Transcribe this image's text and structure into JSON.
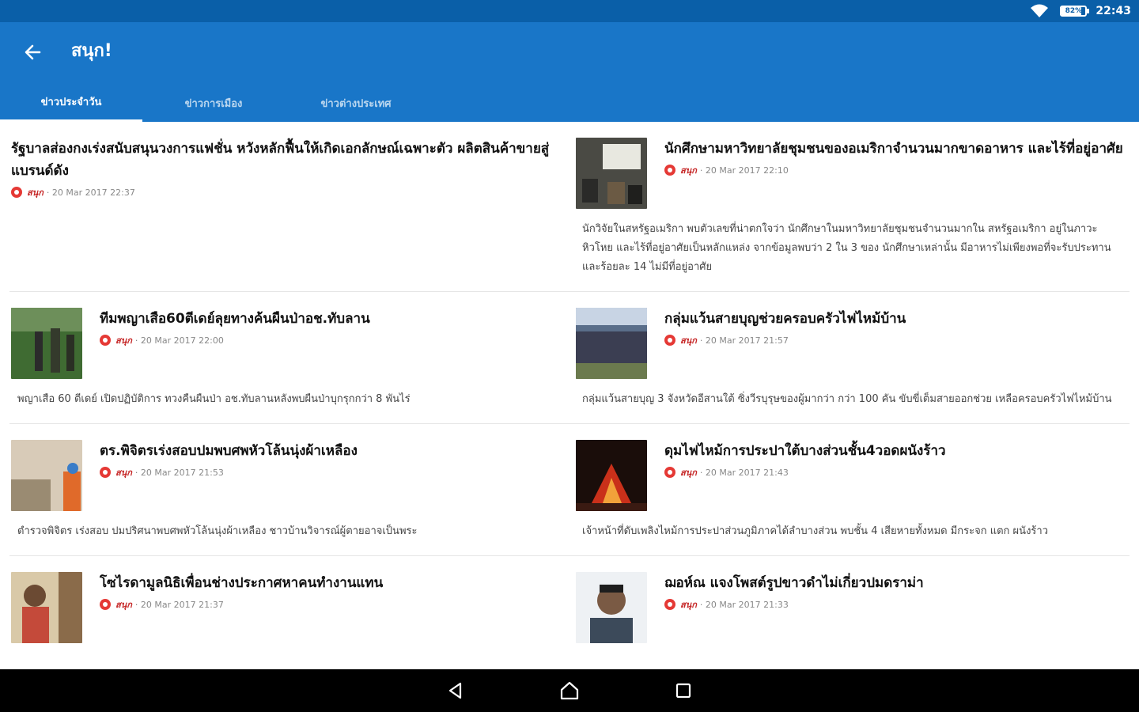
{
  "status": {
    "time": "22:43",
    "battery_text": "82%",
    "battery_level": 0.82
  },
  "appbar": {
    "title": "สนุก!"
  },
  "tabs": [
    "ข่าวประจำวัน",
    "ข่าวการเมือง",
    "ข่าวต่างประเทศ"
  ],
  "articles": [
    {
      "headline": "รัฐบาลส่องกงเร่งสนับสนุนวงการแฟชั่น หวังหลักฟื้นให้เกิดเอกลักษณ์เฉพาะตัว ผลิตสินค้าขายสู่แบรนด์ดัง",
      "source": "สนุก",
      "time": "· 20 Mar 2017 22:37",
      "summary": ""
    },
    {
      "headline": "นักศึกษามหาวิทยาลัยชุมชนของอเมริกาจำนวนมากขาดอาหาร และไร้ที่อยู่อาศัย",
      "source": "สนุก",
      "time": "· 20 Mar 2017 22:10",
      "summary": "นักวิจัยในสหรัฐอเมริกา พบตัวเลขที่น่าตกใจว่า นักศึกษาในมหาวิทยาลัยชุมชนจำนวนมากใน สหรัฐอเมริกา อยู่ในภาวะหิวโหย และไร้ที่อยู่อาศัยเป็นหลักแหล่ง จากข้อมูลพบว่า 2 ใน 3 ของ นักศึกษาเหล่านั้น มีอาหารไม่เพียงพอที่จะรับประทาน และร้อยละ 14 ไม่มีที่อยู่อาศัย"
    },
    {
      "headline": "ทีมพญาเสือ60ตีเดย์ลุยทางค้นผืนป่าอช.ทับลาน",
      "source": "สนุก",
      "time": "· 20 Mar 2017 22:00",
      "summary": "พญาเสือ 60 ตีเดย์ เปิดปฏิบัติการ ทวงคืนผืนป่า อช.ทับลานหลังพบผืนป่าบุกรุกกว่า 8 พันไร่"
    },
    {
      "headline": "กลุ่มแว้นสายบุญช่วยครอบครัวไฟไหม้บ้าน",
      "source": "สนุก",
      "time": "· 20 Mar 2017 21:57",
      "summary": "กลุ่มแว้นสายบุญ 3 จังหวัดอีสานใต้ ซิ่งวีรบุรุษของผู้มากว่า กว่า 100 คัน ขับขี่เต็มสายออกช่วย เหลือครอบครัวไฟไหม้บ้าน"
    },
    {
      "headline": "ตร.พิจิตรเร่งสอบปมพบศพหัวโล้นนุ่งผ้าเหลือง",
      "source": "สนุก",
      "time": "· 20 Mar 2017 21:53",
      "summary": "ตำรวจพิจิตร เร่งสอบ ปมปริศนาพบศพหัวโล้นนุ่งผ้าเหลือง ชาวบ้านวิจารณ์ผู้ตายอาจเป็นพระ"
    },
    {
      "headline": "ดุมไฟไหม้การประปาใต้บางส่วนชั้น4วอดผนังร้าว",
      "source": "สนุก",
      "time": "· 20 Mar 2017 21:43",
      "summary": "เจ้าหน้าที่ดับเพลิงไหม้การประปาส่วนภูมิภาคได้ลำบางส่วน พบชั้น 4 เสียหายทั้งหมด มีกระจก แตก ผนังร้าว"
    },
    {
      "headline": "โซไรดามูลนิธิเพื่อนช่างประกาศหาคนทำงานแทน",
      "source": "สนุก",
      "time": "· 20 Mar 2017 21:37",
      "summary": ""
    },
    {
      "headline": "ฌอห์ณ แจงโพสต์รูปขาวดำไม่เกี่ยวปมดราม่า",
      "source": "สนุก",
      "time": "· 20 Mar 2017 21:33",
      "summary": ""
    }
  ],
  "colors": {
    "status_bar": "#0a5fa8",
    "app_bar": "#1976c8",
    "source_red": "#e53935"
  },
  "icons": {
    "back": "arrow-left-icon",
    "wifi": "wifi-icon",
    "battery": "battery-icon",
    "nav_back": "triangle-back-icon",
    "nav_home": "home-icon",
    "nav_recents": "square-recents-icon"
  }
}
